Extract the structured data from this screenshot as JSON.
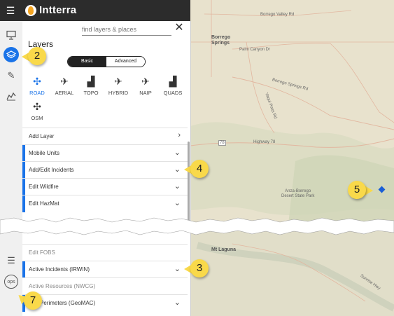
{
  "header": {
    "brand": "Intterra",
    "menu_icon": "hamburger-icon"
  },
  "rail": {
    "items": [
      {
        "name": "presentation-icon",
        "glyph": "▭"
      },
      {
        "name": "layers-icon",
        "glyph": "◈"
      },
      {
        "name": "pencil-icon",
        "glyph": "✎"
      },
      {
        "name": "chart-icon",
        "glyph": "⋀"
      },
      {
        "name": "list-icon",
        "glyph": "☰"
      },
      {
        "name": "ops-badge",
        "glyph": "ops"
      }
    ]
  },
  "panel": {
    "search_placeholder": "find layers & places",
    "title": "Layers",
    "toggle": {
      "basic": "Basic",
      "advanced": "Advanced"
    },
    "basemaps": [
      {
        "label": "ROAD",
        "active": true
      },
      {
        "label": "AERIAL",
        "active": false
      },
      {
        "label": "TOPO",
        "active": false
      },
      {
        "label": "HYBRID",
        "active": false
      },
      {
        "label": "NAIP",
        "active": false
      },
      {
        "label": "QUADS",
        "active": false
      },
      {
        "label": "OSM",
        "active": false
      }
    ],
    "rows_top": [
      {
        "label": "Add Layer"
      },
      {
        "label": "Mobile Units"
      },
      {
        "label": "Add/Edit Incidents"
      },
      {
        "label": "Edit Wildfire"
      },
      {
        "label": "Edit HazMat"
      }
    ],
    "rows_bottom": [
      {
        "label": "Edit FOBS"
      },
      {
        "label": "Active Incidents (IRWIN)"
      },
      {
        "label": "Active Resources (NWCG)"
      },
      {
        "label": "Fire Perimeters (GeoMAC)"
      }
    ]
  },
  "map": {
    "labels": {
      "borrego_springs": "Borrego\nSprings",
      "borrego_valley_rd": "Borrego Valley Rd",
      "palm_canyon_dr": "Palm Canyon Dr",
      "borrego_springs_rd": "Borrego Springs Rd",
      "yaqui_pass_rd": "Yaqui Pass Rd",
      "highway_78": "Highway 78",
      "shield_78": "78",
      "anza_borrego": "Anza-Borrego\nDesert State Park",
      "mt_laguna": "Mt Laguna",
      "sunrise_hwy": "Sunrise Hwy"
    }
  },
  "callouts": [
    "2",
    "4",
    "3",
    "5",
    "7"
  ],
  "colors": {
    "accent": "#1a73e8",
    "callout": "#f9d94a",
    "header": "#2c2c2c"
  }
}
